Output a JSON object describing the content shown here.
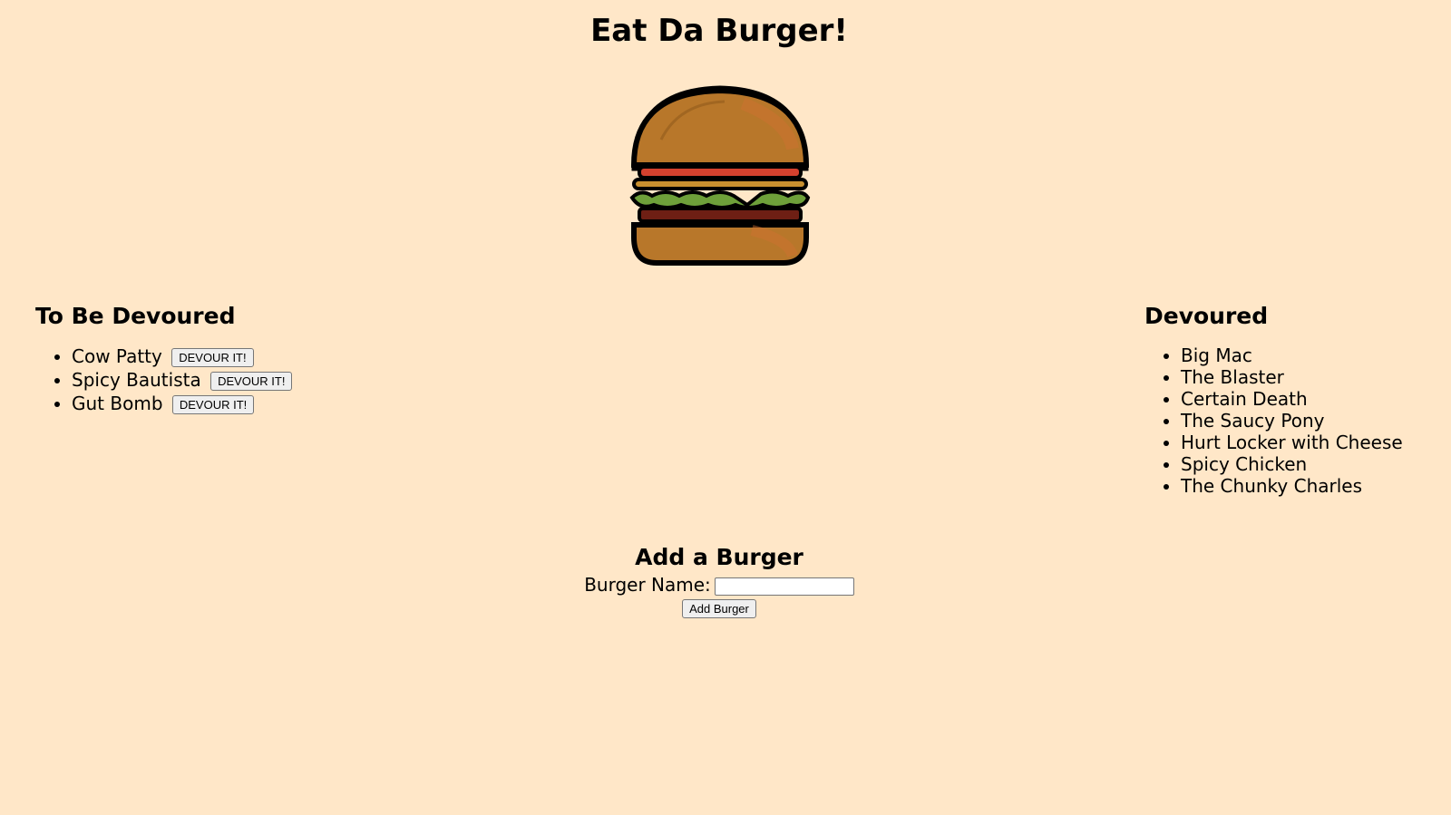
{
  "header": {
    "title": "Eat Da Burger!"
  },
  "logo": {
    "icon": "burger-logo-icon"
  },
  "to_be_devoured": {
    "heading": "To Be Devoured",
    "button_label": "DEVOUR IT!",
    "items": [
      "Cow Patty",
      "Spicy Bautista",
      "Gut Bomb"
    ]
  },
  "devoured": {
    "heading": "Devoured",
    "items": [
      "Big Mac",
      "The Blaster",
      "Certain Death",
      "The Saucy Pony",
      "Hurt Locker with Cheese",
      "Spicy Chicken",
      "The Chunky Charles"
    ]
  },
  "add_form": {
    "heading": "Add a Burger",
    "name_label": "Burger Name:",
    "name_value": "",
    "submit_label": "Add Burger"
  },
  "colors": {
    "background": "#ffe7c8"
  }
}
